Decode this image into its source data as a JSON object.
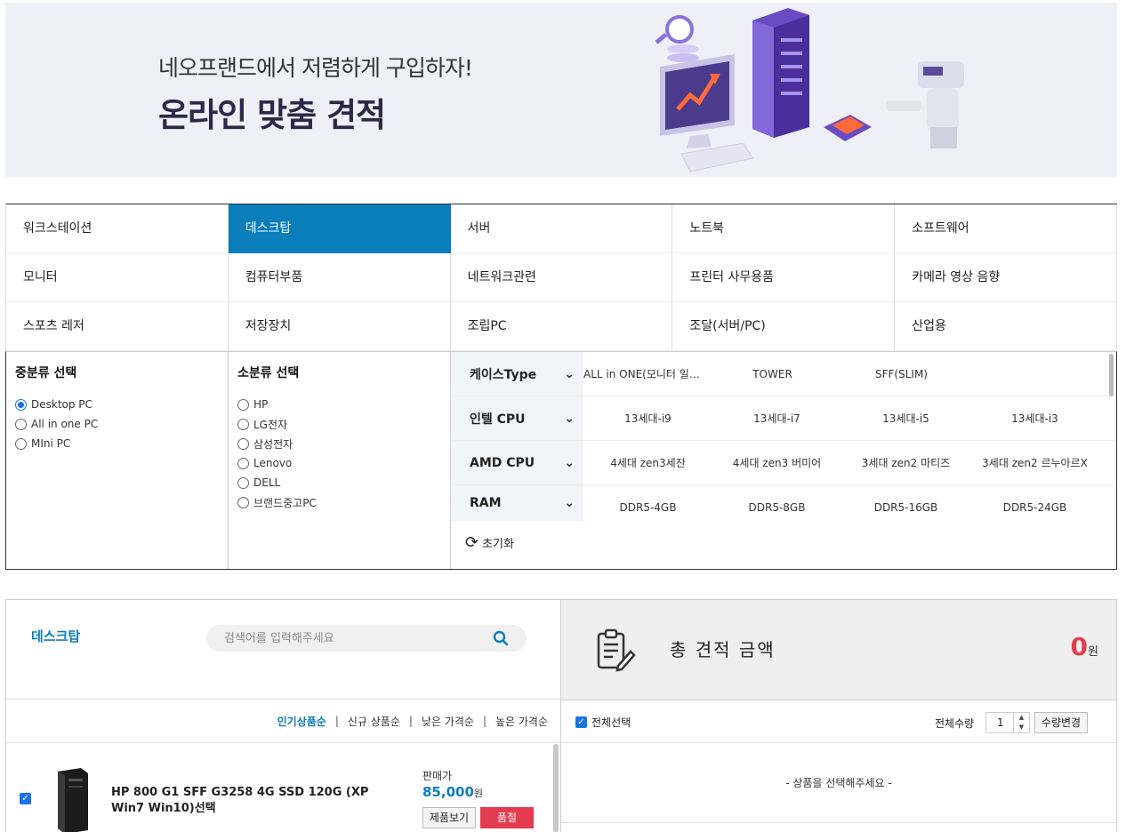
{
  "banner": {
    "subtitle": "네오프랜드에서 저렴하게 구입하자!",
    "title": "온라인 맞춤 견적"
  },
  "categories": [
    [
      "워크스테이션",
      "데스크탑",
      "서버",
      "노트북",
      "소프트웨어"
    ],
    [
      "모니터",
      "컴퓨터부품",
      "네트워크관련",
      "프린터 사무용품",
      "카메라 영상 음향"
    ],
    [
      "스포츠 레저",
      "저장장치",
      "조립PC",
      "조달(서버/PC)",
      "산업용"
    ]
  ],
  "active_category": "데스크탑",
  "filters": {
    "mid": {
      "title": "중분류 선택",
      "options": [
        "Desktop PC",
        "All in one PC",
        "MIni PC"
      ],
      "selected": "Desktop PC"
    },
    "sub": {
      "title": "소분류 선택",
      "options": [
        "HP",
        "LG전자",
        "삼성전자",
        "Lenovo",
        "DELL",
        "브랜드중고PC"
      ]
    },
    "specs": [
      {
        "label": "케이스Type",
        "values": [
          "ALL in ONE(모니터 일체...",
          "TOWER",
          "SFF(SLIM)",
          ""
        ]
      },
      {
        "label": "인텔 CPU",
        "values": [
          "13세대-i9",
          "13세대-i7",
          "13세대-i5",
          "13세대-i3"
        ]
      },
      {
        "label": "AMD CPU",
        "values": [
          "4세대 zen3세잔",
          "4세대 zen3 버미어",
          "3세대 zen2 마티즈",
          "3세대 zen2 르누아르X"
        ]
      },
      {
        "label": "RAM",
        "values": [
          "DDR5-4GB",
          "DDR5-8GB",
          "DDR5-16GB",
          "DDR5-24GB"
        ]
      }
    ],
    "reset_label": "초기화"
  },
  "list": {
    "title": "데스크탑",
    "search_placeholder": "검색어를 입력해주세요",
    "sort": [
      "인기상품순",
      "신규 상품순",
      "낮은 가격순",
      "높은 가격순"
    ],
    "sort_active": "인기상품순",
    "products": [
      {
        "name": "HP 800 G1 SFF G3258 4G SSD 120G (XP Win7 Win10)선택",
        "price_label": "판매가",
        "price": "85,000",
        "currency": "원",
        "detail_button": "제품보기",
        "status_button": "품절",
        "checked": true
      }
    ]
  },
  "estimate": {
    "title": "총 견적 금액",
    "amount": "0",
    "currency": "원",
    "select_all": "전체선택",
    "qty_label": "전체수량",
    "qty_value": "1",
    "qty_button": "수량변경",
    "empty_text": "- 상품을 선택해주세요 -"
  },
  "colors": {
    "accent": "#0a7dbb",
    "danger": "#e33b4f",
    "banner_bg": "#efeff7"
  }
}
